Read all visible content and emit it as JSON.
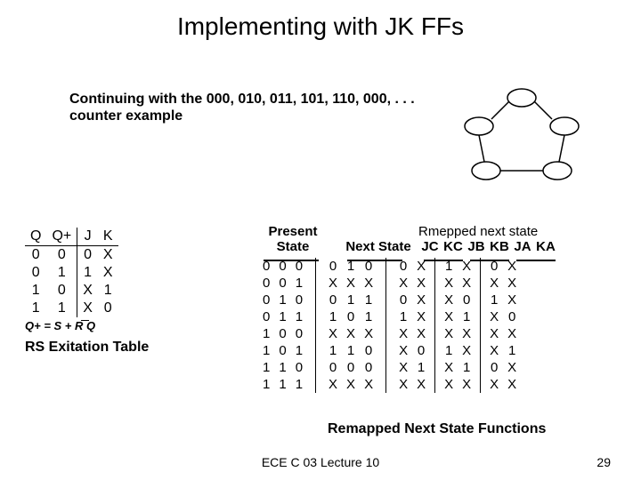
{
  "title": "Implementing with JK FFs",
  "subtitle": "Continuing with the 000, 010, 011, 101, 110, 000, . . . counter example",
  "rs": {
    "headers": [
      "Q",
      "Q+",
      "J",
      "K"
    ],
    "rows": [
      [
        "0",
        "0",
        "0",
        "X"
      ],
      [
        "0",
        "1",
        "1",
        "X"
      ],
      [
        "1",
        "0",
        "X",
        "1"
      ],
      [
        "1",
        "1",
        "X",
        "0"
      ]
    ],
    "eq": "Q+ = S + R Q",
    "caption": "RS Exitation Table"
  },
  "main": {
    "head_present": "Present State",
    "head_next": "Next State",
    "head_remap": "Rmepped next state",
    "head_cols": [
      "JC",
      "KC",
      "JB",
      "KB",
      "JA",
      "KA"
    ],
    "rows": [
      {
        "ps": [
          "0",
          "0",
          "0"
        ],
        "ns": [
          "0",
          "1",
          "0"
        ],
        "r": [
          "0",
          "X",
          "1",
          "X",
          "0",
          "X"
        ]
      },
      {
        "ps": [
          "0",
          "0",
          "1"
        ],
        "ns": [
          "X",
          "X",
          "X"
        ],
        "r": [
          "X",
          "X",
          "X",
          "X",
          "X",
          "X"
        ]
      },
      {
        "ps": [
          "0",
          "1",
          "0"
        ],
        "ns": [
          "0",
          "1",
          "1"
        ],
        "r": [
          "0",
          "X",
          "X",
          "0",
          "1",
          "X"
        ]
      },
      {
        "ps": [
          "0",
          "1",
          "1"
        ],
        "ns": [
          "1",
          "0",
          "1"
        ],
        "r": [
          "1",
          "X",
          "X",
          "1",
          "X",
          "0"
        ]
      },
      {
        "ps": [
          "1",
          "0",
          "0"
        ],
        "ns": [
          "X",
          "X",
          "X"
        ],
        "r": [
          "X",
          "X",
          "X",
          "X",
          "X",
          "X"
        ]
      },
      {
        "ps": [
          "1",
          "0",
          "1"
        ],
        "ns": [
          "1",
          "1",
          "0"
        ],
        "r": [
          "X",
          "0",
          "1",
          "X",
          "X",
          "1"
        ]
      },
      {
        "ps": [
          "1",
          "1",
          "0"
        ],
        "ns": [
          "0",
          "0",
          "0"
        ],
        "r": [
          "X",
          "1",
          "X",
          "1",
          "0",
          "X"
        ]
      },
      {
        "ps": [
          "1",
          "1",
          "1"
        ],
        "ns": [
          "X",
          "X",
          "X"
        ],
        "r": [
          "X",
          "X",
          "X",
          "X",
          "X",
          "X"
        ]
      }
    ],
    "caption": "Remapped Next State Functions"
  },
  "footer": {
    "center": "ECE C 03 Lecture 10",
    "right": "29"
  }
}
